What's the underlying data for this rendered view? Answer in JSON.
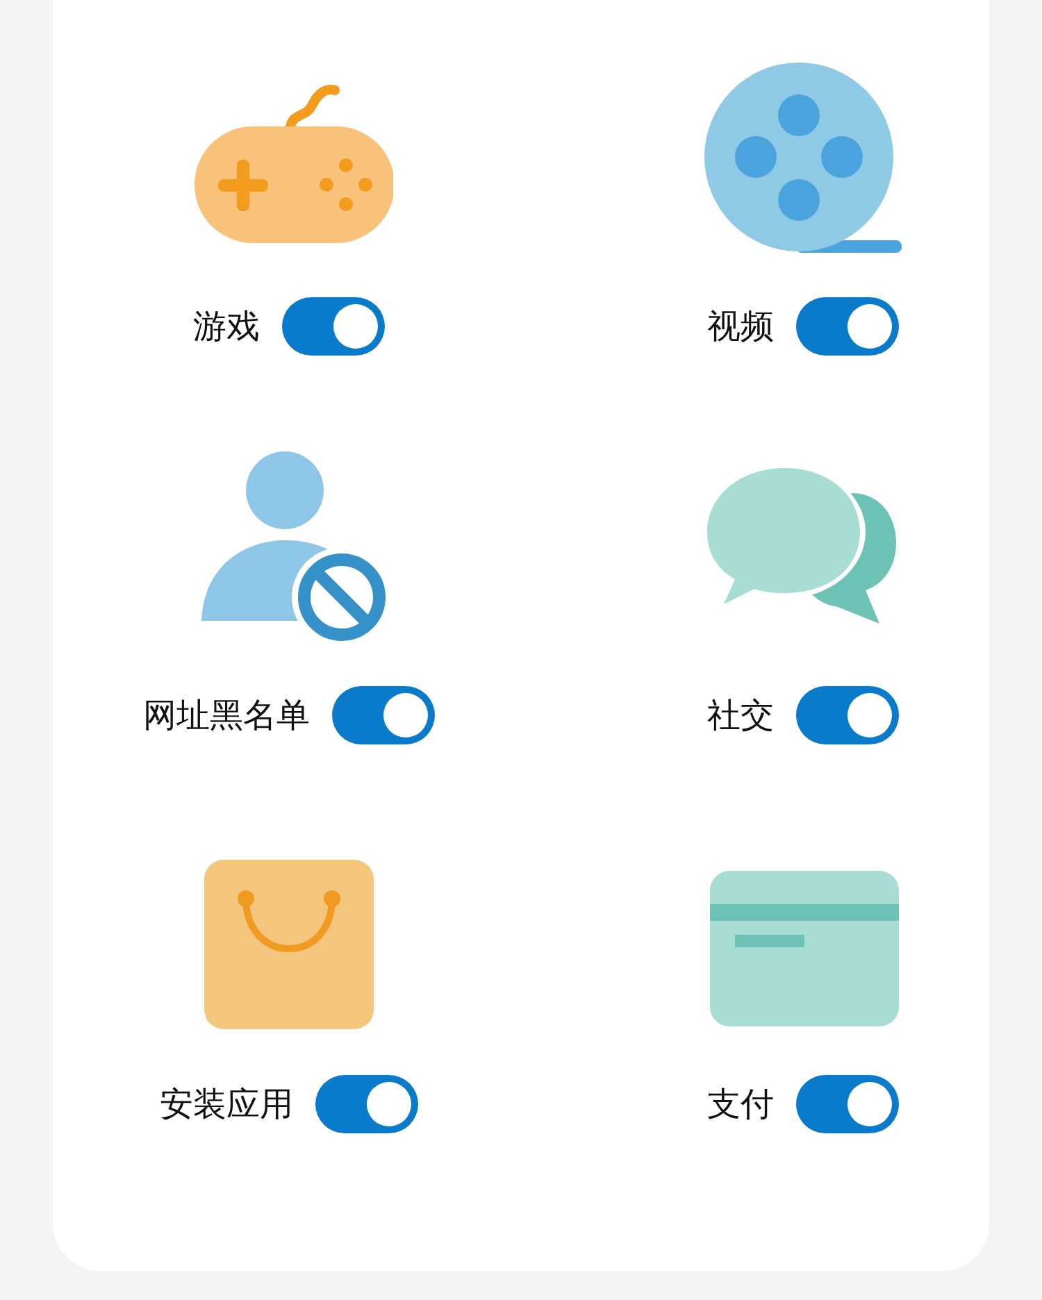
{
  "items": [
    {
      "kind": "game",
      "label": "游戏",
      "on": true
    },
    {
      "kind": "video",
      "label": "视频",
      "on": true
    },
    {
      "kind": "blocklist",
      "label": "网址黑名单",
      "on": true
    },
    {
      "kind": "social",
      "label": "社交",
      "on": true
    },
    {
      "kind": "shopping",
      "label": "安装应用",
      "on": true
    },
    {
      "kind": "payment",
      "label": "支付",
      "on": true
    }
  ]
}
